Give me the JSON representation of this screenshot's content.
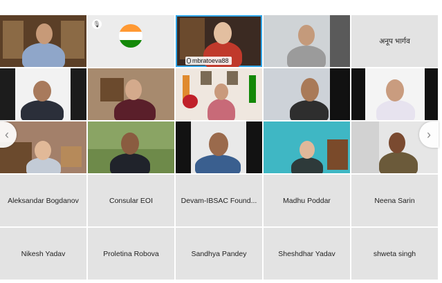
{
  "row1": {
    "flag_tile_icon": "microphone-muted-icon",
    "active_speaker_label": "mbratoeva88",
    "name_only_tile": "अनूप भार्गव"
  },
  "name_tiles_row4": [
    "Aleksandar Bogdanov",
    "Consular EOI",
    "Devam-IBSAC Found...",
    "Madhu Poddar",
    "Neena Sarin"
  ],
  "name_tiles_row5": [
    "Nikesh Yadav",
    "Proletina Robova",
    "Sandhya Pandey",
    "Sheshdhar Yadav",
    "shweta singh"
  ],
  "nav": {
    "prev_icon": "chevron-left-icon",
    "next_icon": "chevron-right-icon",
    "prev_glyph": "‹",
    "next_glyph": "›"
  },
  "colors": {
    "active_border": "#2fa4e7",
    "name_tile_bg": "#e3e3e3",
    "saffron": "#ff9933",
    "green": "#138808"
  }
}
